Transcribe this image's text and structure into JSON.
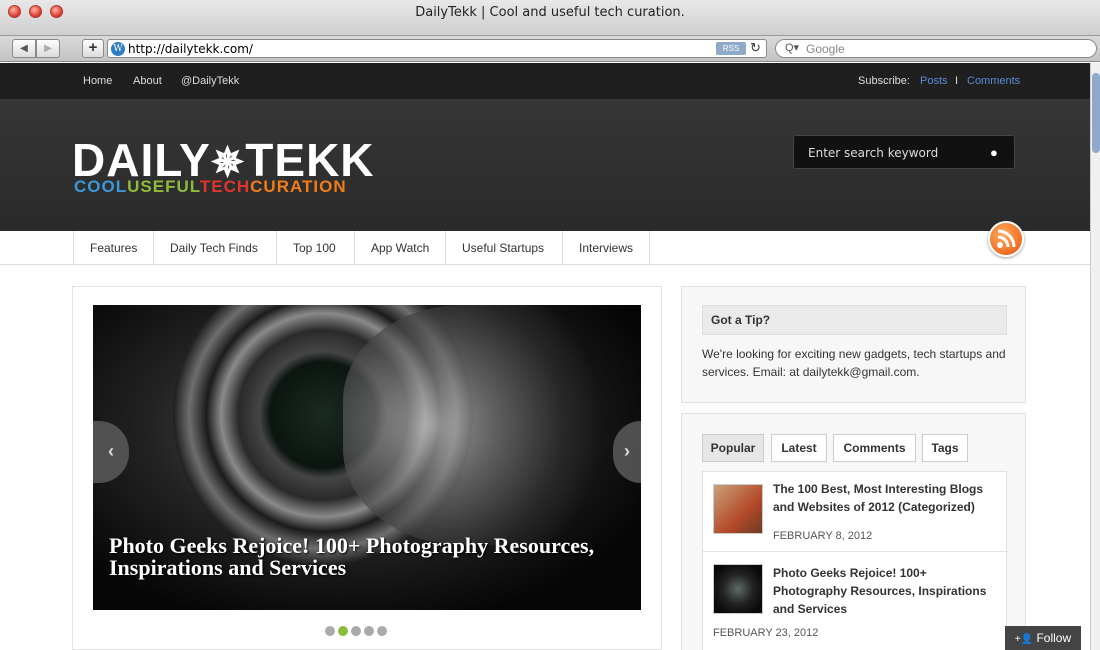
{
  "window": {
    "title": "DailyTekk | Cool and useful tech curation."
  },
  "toolbar": {
    "back_icon": "back-arrow-icon",
    "forward_icon": "forward-arrow-icon",
    "add_label": "+",
    "url": "http://dailytekk.com/",
    "rss_label": "RSS",
    "search_placeholder": "Google"
  },
  "topbar": {
    "links": [
      "Home",
      "About",
      "@DailyTekk"
    ],
    "subscribe_label": "Subscribe:",
    "subscribe_posts": "Posts",
    "subscribe_separator": "I",
    "subscribe_comments": "Comments"
  },
  "header": {
    "logo_left": "DAILY",
    "logo_star": "✵",
    "logo_right": "TEKK",
    "tag_cool": "COOL",
    "tag_useful": "USEFUL",
    "tag_tech": "TECH",
    "tag_curation": "CURATION",
    "search_placeholder": "Enter search keyword"
  },
  "nav": {
    "items": [
      "Features",
      "Daily Tech Finds",
      "Top 100",
      "App Watch",
      "Useful Startups",
      "Interviews"
    ]
  },
  "featured": {
    "caption": "Photo Geeks Rejoice! 100+ Photography Resources, Inspirations and Services",
    "prev_label": "‹",
    "next_label": "›",
    "dots_total": 5,
    "dot_active": 2
  },
  "tip": {
    "title": "Got a Tip?",
    "text": "We're looking for exciting new gadgets, tech startups and services. Email: at dailytekk@gmail.com."
  },
  "tabs": {
    "items": [
      "Popular",
      "Latest",
      "Comments",
      "Tags"
    ],
    "active": "Popular"
  },
  "posts": [
    {
      "title": "The 100 Best, Most Interesting Blogs and Websites of 2012 (Categorized)",
      "date": "FEBRUARY 8, 2012"
    },
    {
      "title": "Photo Geeks Rejoice! 100+ Photography Resources, Inspirations and Services",
      "date": "FEBRUARY 23, 2012"
    }
  ],
  "follow": {
    "label": "Follow",
    "icon": "+👤"
  },
  "colors": {
    "accent_blue": "#5b8dd6",
    "rss_orange": "#e8530e",
    "active_dot": "#8dbb3c"
  }
}
